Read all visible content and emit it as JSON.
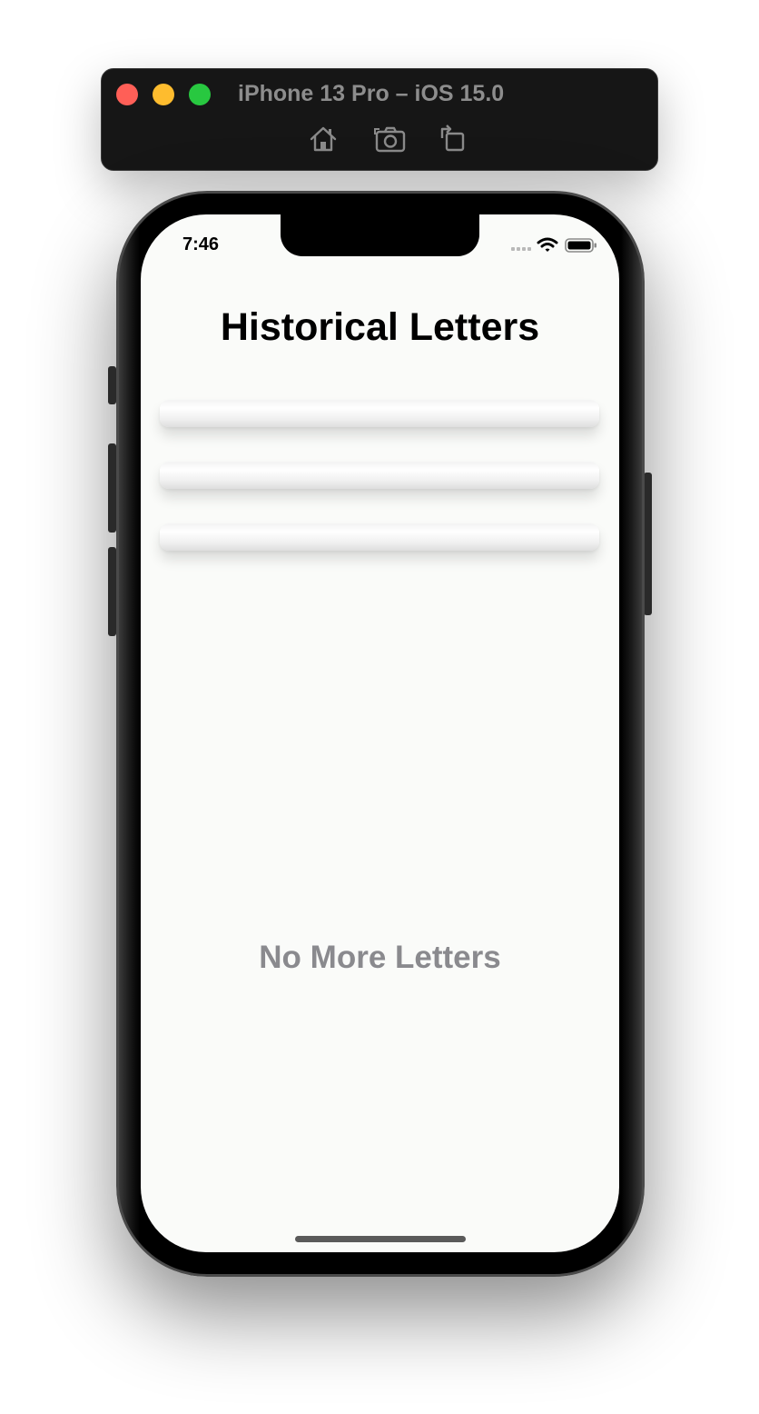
{
  "simulator": {
    "title": "iPhone 13 Pro – iOS 15.0",
    "toolbar": [
      "home-icon",
      "screenshot-icon",
      "rotate-icon"
    ]
  },
  "status_bar": {
    "time": "7:46",
    "icons": [
      "signal-icon",
      "wifi-icon",
      "battery-icon"
    ]
  },
  "app": {
    "title": "Historical Letters",
    "cards": [
      {
        "label": ""
      },
      {
        "label": ""
      },
      {
        "label": ""
      }
    ],
    "empty_label": "No More Letters"
  },
  "colors": {
    "traffic_close": "#ff5f57",
    "traffic_minimize": "#febc2e",
    "traffic_zoom": "#28c840",
    "screen_background": "#fafbf9",
    "empty_label": "#8a8a8e"
  }
}
